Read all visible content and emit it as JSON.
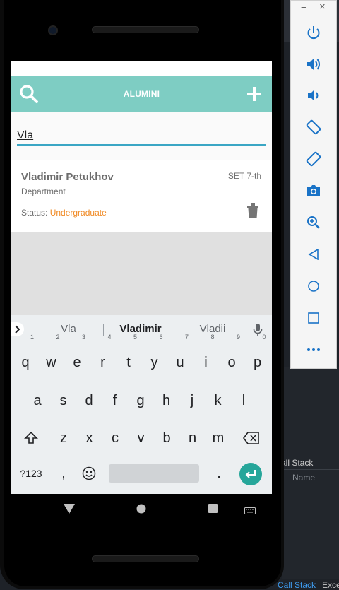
{
  "app": {
    "title": "ALUMINI",
    "search_value": "Vla"
  },
  "record": {
    "name": "Vladimir Petukhov",
    "date": "SET 7-th",
    "department": "Department",
    "status_label": "Status:",
    "status_value": "Undergraduate"
  },
  "keyboard": {
    "suggestions": [
      "Vla",
      "Vladimir",
      "Vladii"
    ],
    "row1": [
      {
        "key": "q",
        "num": "1"
      },
      {
        "key": "w",
        "num": "2"
      },
      {
        "key": "e",
        "num": "3"
      },
      {
        "key": "r",
        "num": "4"
      },
      {
        "key": "t",
        "num": "5"
      },
      {
        "key": "y",
        "num": "6"
      },
      {
        "key": "u",
        "num": "7"
      },
      {
        "key": "i",
        "num": "8"
      },
      {
        "key": "o",
        "num": "9"
      },
      {
        "key": "p",
        "num": "0"
      }
    ],
    "row2": [
      "a",
      "s",
      "d",
      "f",
      "g",
      "h",
      "j",
      "k",
      "l"
    ],
    "row3": [
      "z",
      "x",
      "c",
      "v",
      "b",
      "n",
      "m"
    ],
    "symbols_label": "?123",
    "comma": ",",
    "period": "."
  },
  "ide": {
    "call_stack_label": "all Stack",
    "name_label": "Name",
    "bottom_call_stack": "Call Stack",
    "bottom_exce": "Exce"
  },
  "emulator": {
    "minimize": "−",
    "close": "×",
    "icons": [
      "power-icon",
      "volume-up-icon",
      "volume-down-icon",
      "rotate-left-icon",
      "rotate-right-icon",
      "camera-icon",
      "zoom-icon",
      "back-icon",
      "home-icon",
      "overview-icon",
      "more-icon"
    ]
  },
  "colors": {
    "appbar": "#7ecdc3",
    "status_value": "#f08a24",
    "search_underline": "#3aa6c4",
    "enter_key": "#26a69a",
    "ide_link": "#3e9cf0"
  }
}
